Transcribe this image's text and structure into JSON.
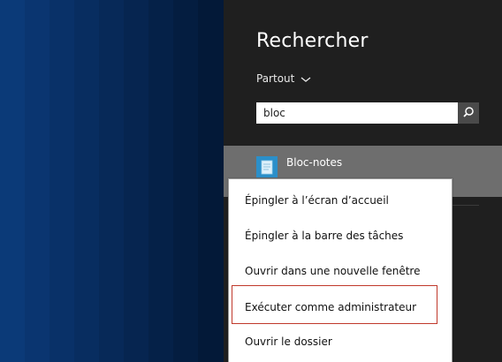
{
  "search_pane": {
    "title": "Rechercher",
    "scope_label": "Partout",
    "query_value": "bloc",
    "result": {
      "label": "Bloc-notes",
      "icon": "notepad-icon"
    }
  },
  "context_menu": {
    "items": [
      "Épingler à l’écran d’accueil",
      "Épingler à la barre des tâches",
      "Ouvrir dans une nouvelle fenêtre",
      "Exécuter comme administrateur",
      "Ouvrir le dossier"
    ]
  },
  "colors": {
    "pane_bg": "#1f1f1f",
    "result_bg": "#6e6e6e",
    "highlight": "#c0392b"
  }
}
